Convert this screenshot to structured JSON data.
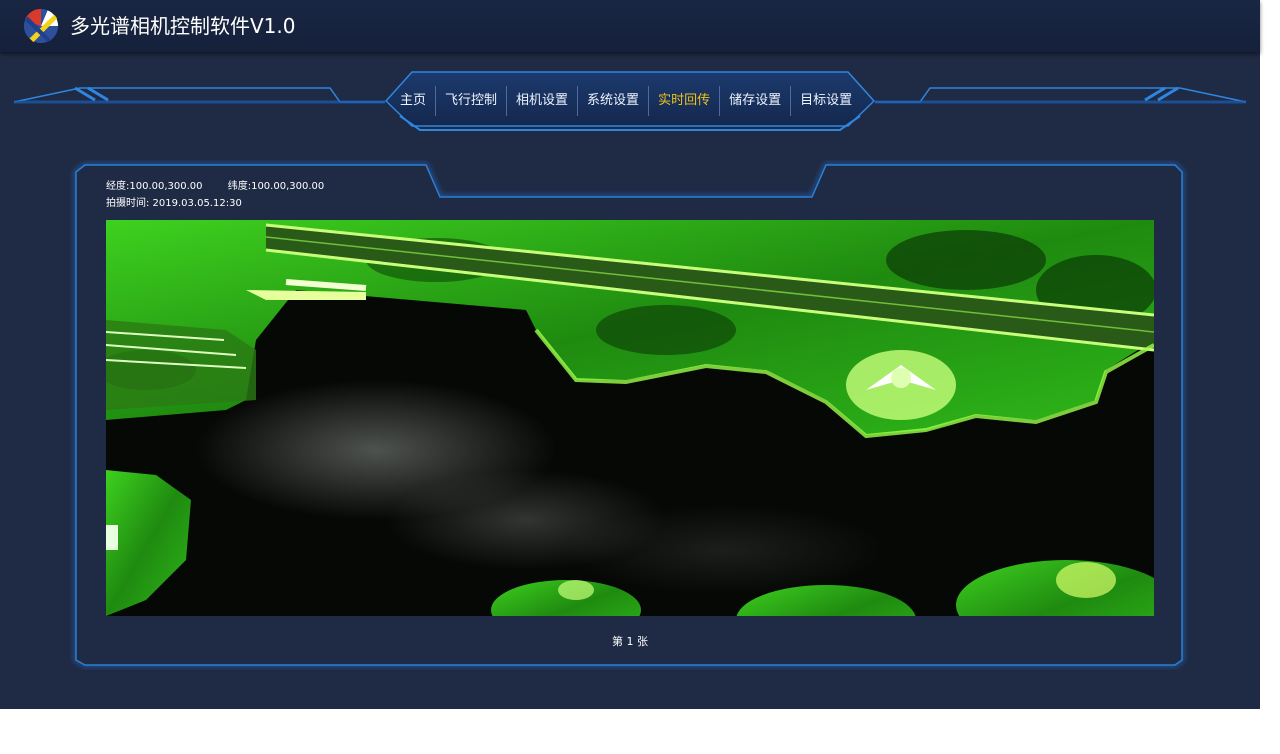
{
  "app": {
    "title": "多光谱相机控制软件V1.0"
  },
  "nav": {
    "items": [
      "主页",
      "飞行控制",
      "相机设置",
      "系统设置",
      "实时回传",
      "储存设置",
      "目标设置"
    ],
    "active_index": 4,
    "active_color": "#f1c21b"
  },
  "info": {
    "longitude": "经度:100.00,300.00",
    "latitude": "纬度:100.00,300.00",
    "capture_time": "拍摄时间: 2019.03.05.12:30"
  },
  "footer": {
    "page_counter": "第 1 张"
  },
  "colors": {
    "background": "#1f2a45",
    "frame": "#2a7fd6",
    "vegetation": "#39d21a"
  }
}
